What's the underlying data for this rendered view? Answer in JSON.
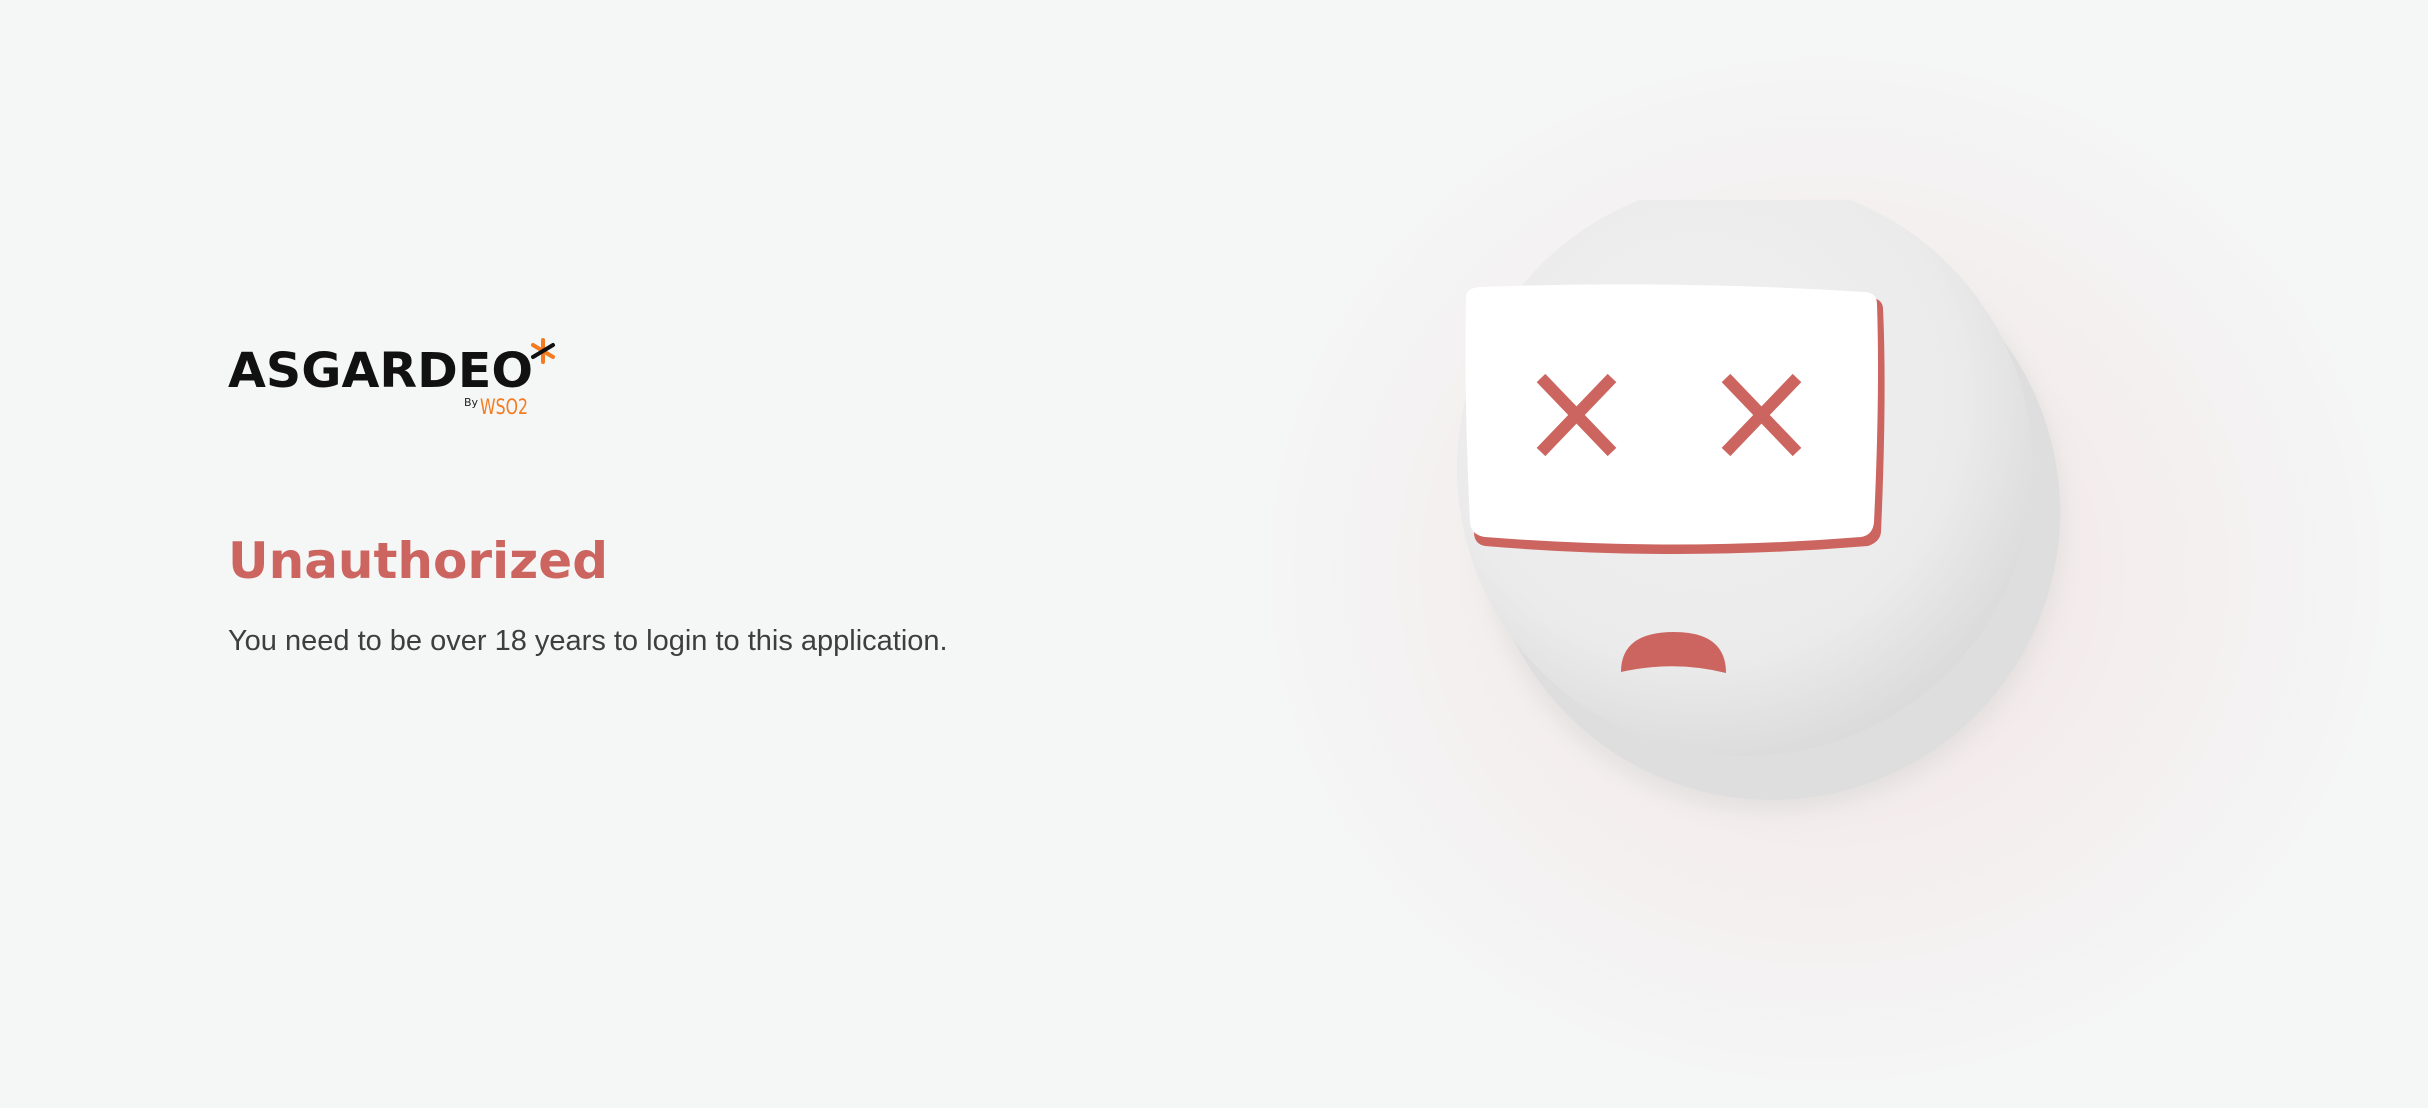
{
  "brand": {
    "name": "ASGARDEO",
    "by_label": "By",
    "company": "WSO2"
  },
  "error": {
    "title": "Unauthorized",
    "message": "You need to be over 18 years to login to this application."
  },
  "colors": {
    "accent": "#cc6560",
    "logo_orange": "#f47b20",
    "background": "#f5f6f6",
    "message_text": "#3e3e3e"
  },
  "illustration": {
    "icon": "sad-face-x-eyes-icon"
  }
}
